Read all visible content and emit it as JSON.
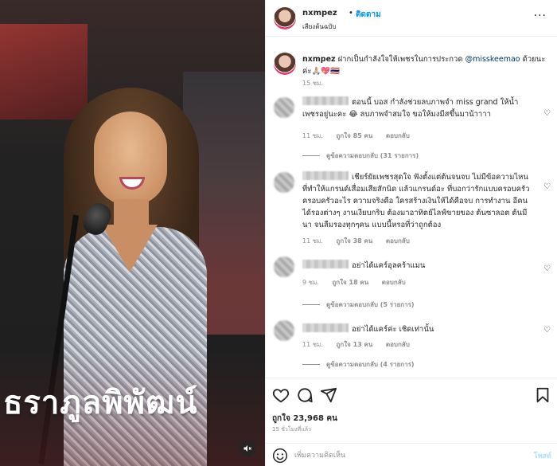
{
  "media": {
    "overlay_text": "ธราภูลพิพัฒน์"
  },
  "header": {
    "username": "nxmpez",
    "separator": "•",
    "follow_label": "ติดตาม",
    "audio_label": "เสียงต้นฉบับ",
    "more_label": "···"
  },
  "caption": {
    "username": "nxmpez",
    "text": "ฝากเป็นกำลังใจให้เพชรในการประกวด ",
    "mention": "@misskeemao",
    "text_after": " ด้วยนะค่ะ🙏🏼💖🇹🇭",
    "time": "15 ชม."
  },
  "comments": [
    {
      "text": "ตอนนี้ บอส กำลังช่วยลบภาพจำ miss grand ให้น้ำเพชรอยู่นะคะ 😂 ลบภาพจำสมใจ ขอให้มงมีสขึ้นมาน้าาาา",
      "time": "11 ชม.",
      "likes": "ถูกใจ 85 คน",
      "reply": "ตอบกลับ",
      "view_replies": "ดูข้อความตอบกลับ (31 รายการ)"
    },
    {
      "text": "เชียร์ยัยเพชรสุดใจ ฟังตั้งแต่ต้นจนจบ ไม่มีข้อความไหนที่ทำให้แกรนด์เสื่อมเสียสักนิด แล้วแกรนด์อะ ที่บอกว่ารักแบบครอบครัว ครอบครัวอะไร ความจริงคือ ใครสร้างเงินให้ได้คือจบ การทำงาน อีคน ได้รองต่างๆ งานเงียบกริบ ต้องมาอาทิตย์ไลฟ์ขายของ ต้นซาลอต ต้นมีนา จนลืมรองทุกๆคน แบบนี้หรอที่ว่าถูกต้อง",
      "time": "11 ชม.",
      "likes": "ถูกใจ 38 คน",
      "reply": "ตอบกลับ",
      "view_replies": ""
    },
    {
      "text": "อย่าได้แคร์อุลคร้าแมน",
      "time": "9 ชม.",
      "likes": "ถูกใจ 18 คน",
      "reply": "ตอบกลับ",
      "view_replies": "ดูข้อความตอบกลับ (5 รายการ)"
    },
    {
      "text": "อย่าได้แคร์ค่ะ เชิดเท่านั้น",
      "time": "11 ชม.",
      "likes": "ถูกใจ 13 คน",
      "reply": "ตอบกลับ",
      "view_replies": "ดูข้อความตอบกลับ (4 รายการ)"
    }
  ],
  "footer": {
    "likes": "ถูกใจ 23,968 คน",
    "time": "15 ชั่วโมงที่แล้ว",
    "comment_placeholder": "เพิ่มความคิดเห็น",
    "post_label": "โพสต์"
  },
  "colors": {
    "accent": "#0095f6",
    "mention": "#00376b",
    "muted": "#8e8e8e",
    "post_disabled": "#b2dffc"
  }
}
